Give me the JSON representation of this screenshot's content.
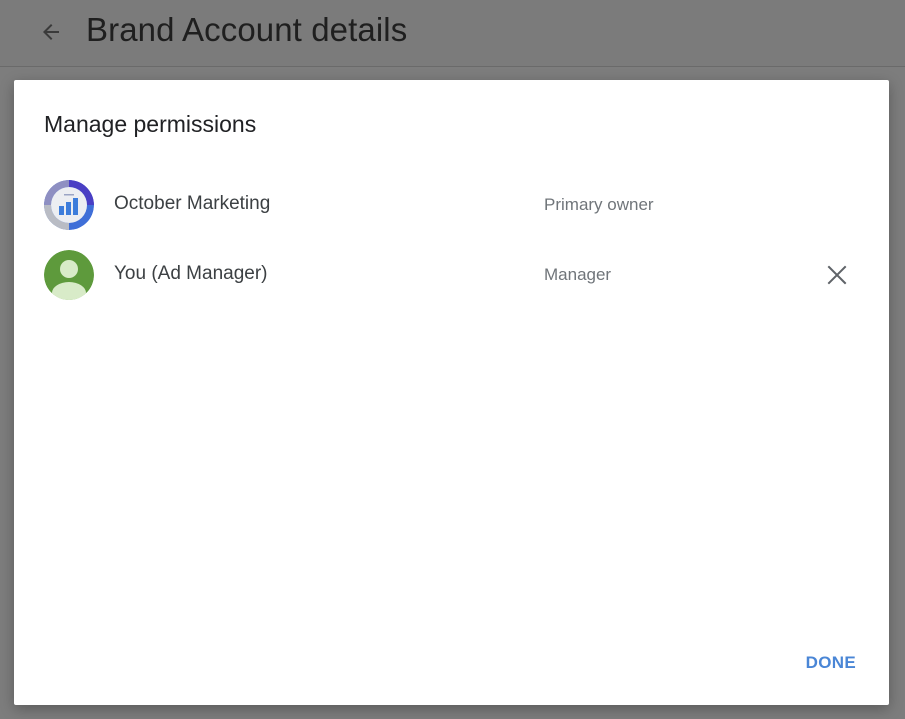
{
  "header": {
    "back_icon": "arrow-left-icon",
    "title": "Brand Account details"
  },
  "dialog": {
    "title": "Manage permissions",
    "members": [
      {
        "name": "October Marketing",
        "role": "Primary owner",
        "avatar_icon": "bar-chart-logo-icon",
        "removable": false
      },
      {
        "name": "You (Ad Manager)",
        "role": "Manager",
        "avatar_icon": "person-avatar-icon",
        "remove_icon": "close-icon",
        "removable": true
      }
    ],
    "done_label": "DONE"
  },
  "colors": {
    "overlay": "#7d7d7d",
    "dialog_bg": "#ffffff",
    "accent": "#4a86d6",
    "avatar_green": "#5e9a3c"
  }
}
